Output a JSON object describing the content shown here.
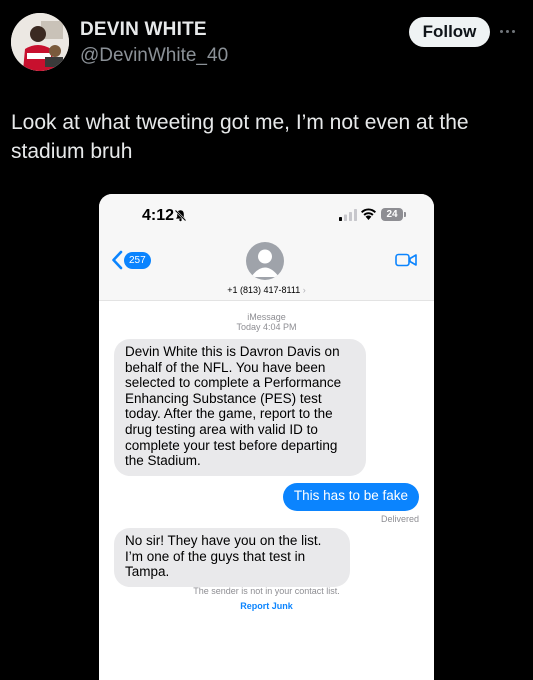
{
  "tweet": {
    "display_name": "DEVIN WHITE",
    "handle": "@DevinWhite_40",
    "follow_label": "Follow",
    "more_icon": "more-dots-icon",
    "text": "Look at what tweeting got me, I’m not even at the stadium bruh"
  },
  "phone": {
    "status_bar": {
      "time": "4:12",
      "bell_icon": "bell-slash-icon",
      "battery": "24"
    },
    "conversation_header": {
      "back_count": "257",
      "contact_number": "+1 (813) 417-8111",
      "contact_chevron": "›",
      "video_icon": "video-camera-icon"
    },
    "thread": {
      "service_label": "iMessage",
      "timestamp": "Today 4:04 PM",
      "messages": [
        {
          "direction": "incoming",
          "text": "Devin White this is Davron Davis on behalf of the NFL. You have been selected to complete a Performance Enhancing Substance (PES) test today. After the game, report to the drug testing area with valid ID to complete your test before departing the Stadium."
        },
        {
          "direction": "outgoing",
          "text": "This has to be fake"
        },
        {
          "direction": "incoming",
          "text": "No sir! They have you on the list. I’m one of the guys that test in Tampa."
        }
      ],
      "delivered_label": "Delivered",
      "sender_notice": "The sender is not in your contact list.",
      "report_junk_label": "Report Junk"
    }
  },
  "colors": {
    "background": "#000000",
    "imessage_blue": "#0b84fe",
    "incoming_bubble": "#e9e9eb",
    "follow_button": "#eff3f4"
  }
}
